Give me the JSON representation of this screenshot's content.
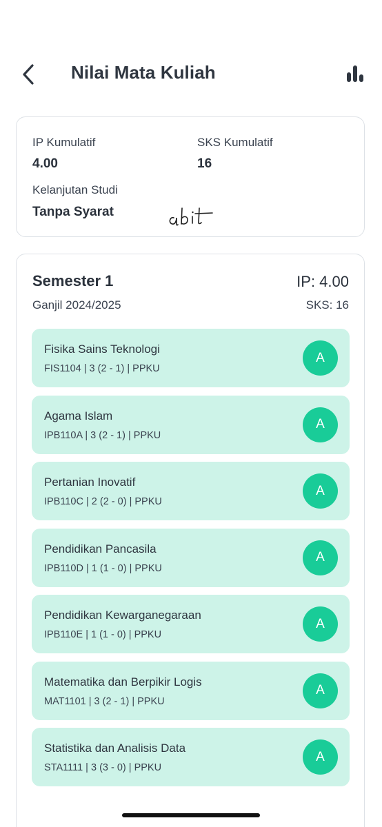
{
  "header": {
    "title": "Nilai Mata Kuliah",
    "back_icon": "chevron-left-icon",
    "stats_icon": "bar-chart-icon"
  },
  "summary": {
    "ip_label": "IP Kumulatif",
    "ip_value": "4.00",
    "sks_label": "SKS Kumulatif",
    "sks_value": "16",
    "status_label": "Kelanjutan Studi",
    "status_value": "Tanpa Syarat",
    "handwriting": "abit"
  },
  "semester": {
    "title": "Semester 1",
    "period": "Ganjil 2024/2025",
    "ip": "IP: 4.00",
    "sks": "SKS: 16",
    "courses": [
      {
        "name": "Fisika Sains Teknologi",
        "meta": "FIS1104 | 3 (2 - 1) | PPKU",
        "grade": "A"
      },
      {
        "name": "Agama Islam",
        "meta": "IPB110A | 3 (2 - 1) | PPKU",
        "grade": "A"
      },
      {
        "name": "Pertanian Inovatif",
        "meta": "IPB110C | 2 (2 - 0) | PPKU",
        "grade": "A"
      },
      {
        "name": "Pendidikan Pancasila",
        "meta": "IPB110D | 1 (1 - 0) | PPKU",
        "grade": "A"
      },
      {
        "name": "Pendidikan Kewarganegaraan",
        "meta": "IPB110E | 1 (1 - 0) | PPKU",
        "grade": "A"
      },
      {
        "name": "Matematika dan Berpikir Logis",
        "meta": "MAT1101 | 3 (2 - 1) | PPKU",
        "grade": "A"
      },
      {
        "name": "Statistika dan Analisis Data",
        "meta": "STA1111 | 3 (3 - 0) | PPKU",
        "grade": "A"
      }
    ]
  },
  "colors": {
    "course_bg": "#cdf3e8",
    "grade_badge": "#19cc98",
    "text": "#2f3640"
  }
}
